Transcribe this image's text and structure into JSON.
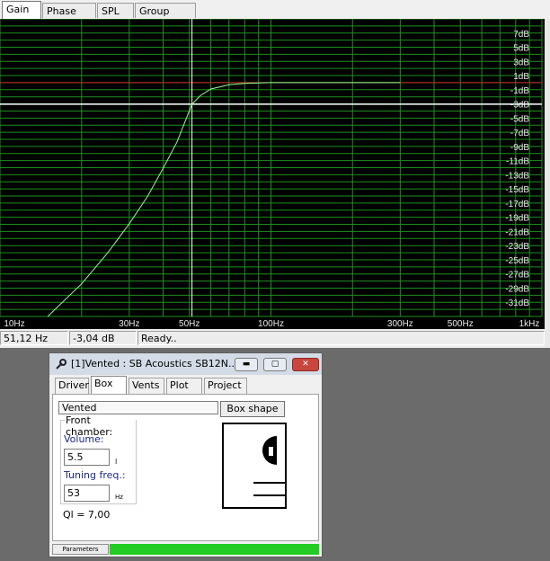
{
  "tabs": [
    "Gain",
    "Phase plot",
    "SPL",
    "Group delay"
  ],
  "active_tab": "Gain",
  "chart_data": {
    "type": "line",
    "xscale": "log",
    "xlim": [
      10,
      1000
    ],
    "ylim": [
      -33,
      9
    ],
    "x_tick_labels": [
      "10Hz",
      "30Hz",
      "50Hz",
      "100Hz",
      "300Hz",
      "500Hz",
      "1kHz"
    ],
    "y_tick_labels": [
      "7dB",
      "5dB",
      "3dB",
      "1dB",
      "-1dB",
      "-3dB",
      "-5dB",
      "-7dB",
      "-9dB",
      "-11dB",
      "-13dB",
      "-15dB",
      "-17dB",
      "-19dB",
      "-21dB",
      "-23dB",
      "-25dB",
      "-27dB",
      "-29dB",
      "-31dB"
    ],
    "x": [
      15,
      20,
      25,
      30,
      35,
      40,
      45,
      51.12,
      55,
      60,
      70,
      80,
      100,
      130,
      200,
      300
    ],
    "values": [
      -33,
      -28.4,
      -24,
      -19.9,
      -16.1,
      -12.1,
      -8.4,
      -3.04,
      -1.8,
      -0.9,
      -0.3,
      -0.1,
      0,
      0,
      0,
      0
    ],
    "cursor_x": 51.12,
    "cursor_y": -3.04,
    "reference_level": 0,
    "colors": {
      "background": "#000000",
      "grid": "#1f8f1f",
      "curve": "#8fff8f",
      "cursor": "#ffffff",
      "reference": "#cc2020",
      "cursor_level": "#ff66ff"
    }
  },
  "status": {
    "frequency": "51,12 Hz",
    "gain": "-3,04 dB",
    "message": "Ready.."
  },
  "dialog": {
    "title": "[1]Vented : SB Acoustics SB12N...",
    "window_buttons": {
      "minimize": "▬",
      "maximize": "▢",
      "close": "✕"
    },
    "tabs": [
      "Driver",
      "Box",
      "Vents",
      "Plot",
      "Project"
    ],
    "active_tab": "Box",
    "box_type": "Vented",
    "box_shape_label": "Box shape",
    "front_chamber_label": "Front chamber:",
    "volume_label": "Volume:",
    "volume_value": "5.5",
    "volume_unit": "l",
    "tuning_label": "Tuning freq.:",
    "tuning_value": "53",
    "tuning_unit": "Hz",
    "ql_text": "Ql = 7,00",
    "progress_label": "Parameters",
    "progress": 1.0,
    "progress_color": "#22cc22"
  }
}
